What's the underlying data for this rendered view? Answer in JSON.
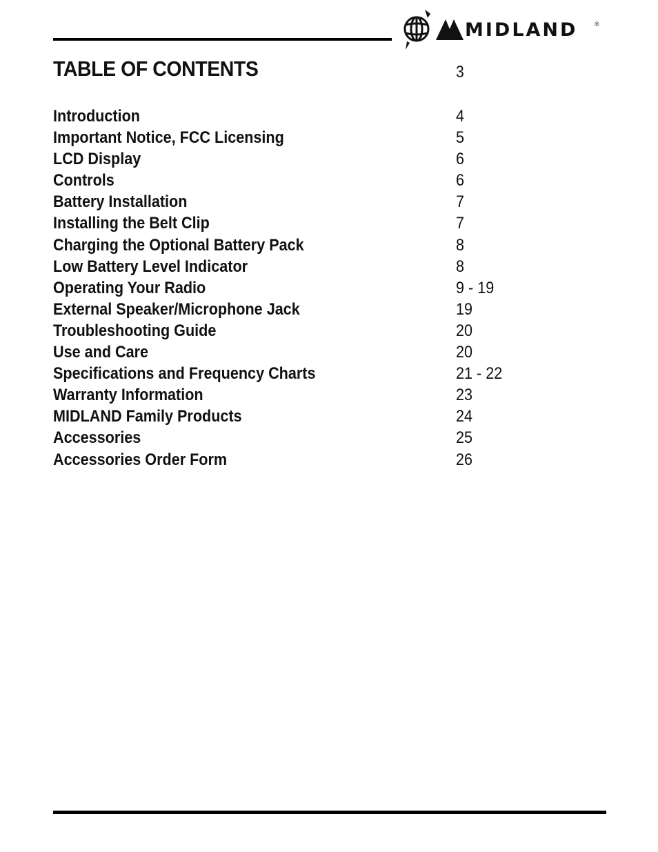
{
  "header": {
    "brand": "MIDLAND",
    "registered_mark": "®",
    "logo_icon": "globe-icon"
  },
  "title": {
    "label": "TABLE OF CONTENTS",
    "page": "3"
  },
  "toc": [
    {
      "label": "Introduction",
      "page": "4"
    },
    {
      "label": "Important Notice, FCC Licensing",
      "page": "5"
    },
    {
      "label": "LCD Display",
      "page": "6"
    },
    {
      "label": "Controls",
      "page": "6"
    },
    {
      "label": "Battery Installation",
      "page": "7"
    },
    {
      "label": "Installing the Belt Clip",
      "page": "7"
    },
    {
      "label": "Charging the Optional Battery Pack",
      "page": "8"
    },
    {
      "label": "Low Battery Level Indicator",
      "page": "8"
    },
    {
      "label": "Operating Your Radio",
      "page": "9 - 19"
    },
    {
      "label": "External Speaker/Microphone Jack",
      "page": "19"
    },
    {
      "label": "Troubleshooting Guide",
      "page": "20"
    },
    {
      "label": "Use and Care",
      "page": "20"
    },
    {
      "label": "Specifications and Frequency Charts",
      "page": "21 - 22"
    },
    {
      "label": "Warranty Information",
      "page": "23"
    },
    {
      "label": "MIDLAND Family Products",
      "page": "24"
    },
    {
      "label": "Accessories",
      "page": "25"
    },
    {
      "label": "Accessories Order Form",
      "page": "26"
    }
  ]
}
